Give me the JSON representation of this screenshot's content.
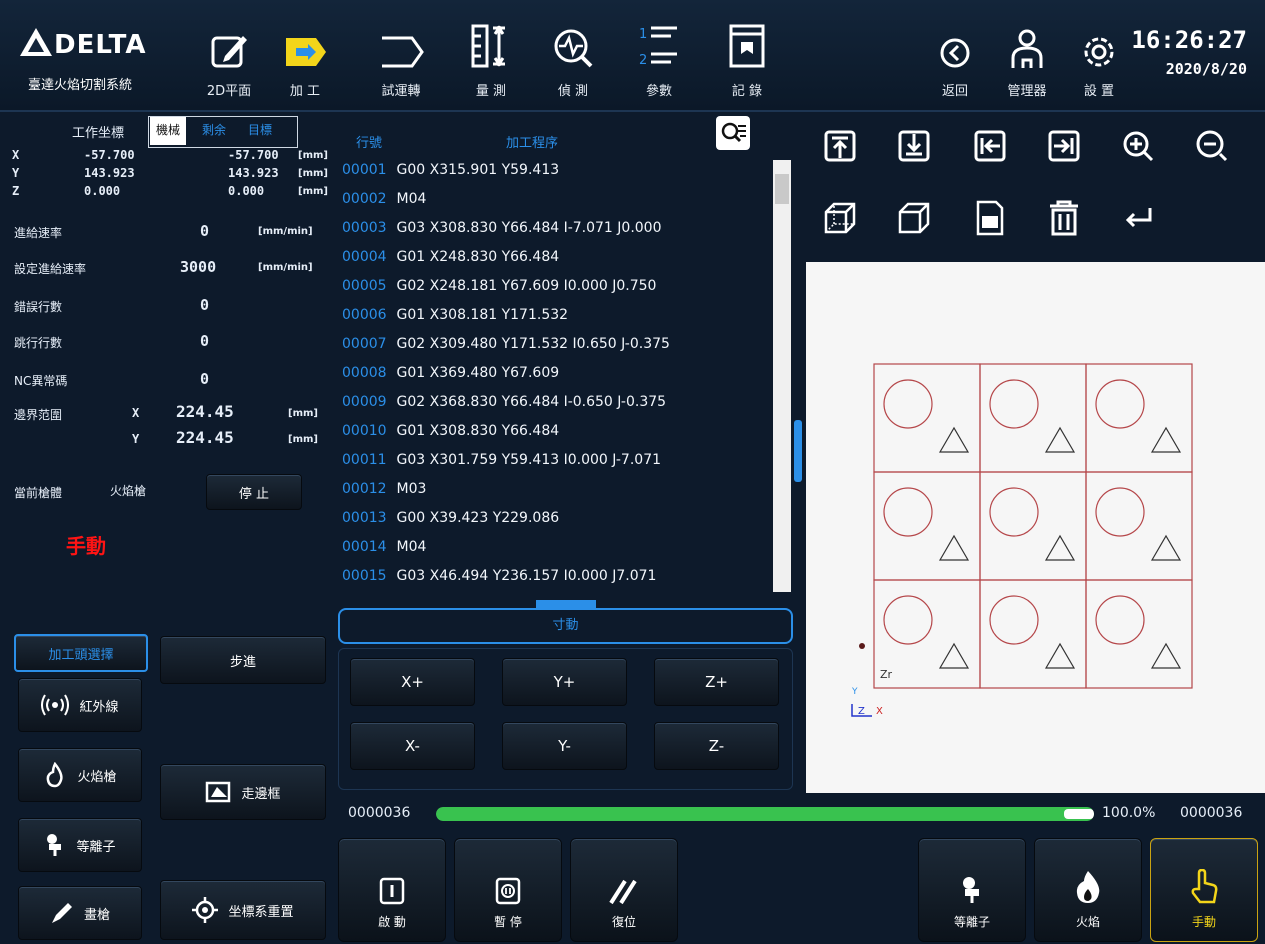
{
  "brand": {
    "name": "DELTA",
    "subtitle": "臺達火焰切割系統"
  },
  "toolbar": [
    {
      "key": "plane",
      "label": "2D平面",
      "icon": "edit-icon"
    },
    {
      "key": "process",
      "label": "加 工",
      "icon": "arrow-right-icon"
    },
    {
      "key": "trial",
      "label": "試運轉",
      "icon": "trial-run-icon"
    },
    {
      "key": "measure",
      "label": "量 測",
      "icon": "measure-icon"
    },
    {
      "key": "detect",
      "label": "偵 測",
      "icon": "detect-icon"
    },
    {
      "key": "params",
      "label": "參數",
      "icon": "parameters-icon"
    },
    {
      "key": "record",
      "label": "記 錄",
      "icon": "record-icon"
    },
    {
      "key": "back",
      "label": "返回",
      "icon": "back-icon"
    },
    {
      "key": "manager",
      "label": "管理器",
      "icon": "user-icon"
    },
    {
      "key": "settings",
      "label": "設 置",
      "icon": "gear-icon"
    }
  ],
  "clock": {
    "time": "16:26:27",
    "date": "2020/8/20"
  },
  "coords": {
    "header": "工作坐標",
    "tabs": [
      "機械",
      "剩余",
      "目標"
    ],
    "axes": [
      {
        "axis": "X",
        "work": "-57.700",
        "machine": "-57.700",
        "unit": "[mm]"
      },
      {
        "axis": "Y",
        "work": "143.923",
        "machine": "143.923",
        "unit": "[mm]"
      },
      {
        "axis": "Z",
        "work": "0.000",
        "machine": "0.000",
        "unit": "[mm]"
      }
    ]
  },
  "status": {
    "feed_label": "進給速率",
    "feed_value": "0",
    "feed_unit": "[mm/min]",
    "set_feed_label": "設定進給速率",
    "set_feed_value": "3000",
    "set_feed_unit": "[mm/min]",
    "err_label": "錯誤行數",
    "err_value": "0",
    "skip_label": "跳行行數",
    "skip_value": "0",
    "nc_label": "NC異常碼",
    "nc_value": "0",
    "boundary_label": "邊界范圍",
    "bx_label": "X",
    "bx_value": "224.45",
    "by_label": "Y",
    "by_value": "224.45",
    "b_unit": "[mm]",
    "torch_label": "當前槍體",
    "torch_value": "火焰槍",
    "stop_label": "停 止",
    "mode": "手動"
  },
  "program": {
    "col_line": "行號",
    "col_program": "加工程序",
    "lines": [
      {
        "n": "00001",
        "code": "G00 X315.901 Y59.413"
      },
      {
        "n": "00002",
        "code": "M04"
      },
      {
        "n": "00003",
        "code": "G03 X308.830 Y66.484 I-7.071 J0.000"
      },
      {
        "n": "00004",
        "code": "G01 X248.830 Y66.484"
      },
      {
        "n": "00005",
        "code": "G02 X248.181 Y67.609 I0.000 J0.750"
      },
      {
        "n": "00006",
        "code": "G01 X308.181 Y171.532"
      },
      {
        "n": "00007",
        "code": "G02 X309.480 Y171.532 I0.650 J-0.375"
      },
      {
        "n": "00008",
        "code": "G01 X369.480 Y67.609"
      },
      {
        "n": "00009",
        "code": "G02 X368.830 Y66.484 I-0.650 J-0.375"
      },
      {
        "n": "00010",
        "code": "G01 X308.830 Y66.484"
      },
      {
        "n": "00011",
        "code": "G03 X301.759 Y59.413 I0.000 J-7.071"
      },
      {
        "n": "00012",
        "code": "M03"
      },
      {
        "n": "00013",
        "code": "G00 X39.423 Y229.086"
      },
      {
        "n": "00014",
        "code": "M04"
      },
      {
        "n": "00015",
        "code": "G03 X46.494 Y236.157 I0.000 J7.071"
      }
    ]
  },
  "jog": {
    "title": "寸動",
    "buttons": [
      "X+",
      "Y+",
      "Z+",
      "X-",
      "Y-",
      "Z-"
    ]
  },
  "left_buttons": {
    "select": "加工頭選擇",
    "step": "步進",
    "infrared": "紅外線",
    "flame": "火焰槍",
    "plasma": "等離子",
    "pen": "畫槍",
    "frame": "走邊框",
    "reset_coord": "坐標系重置"
  },
  "progress": {
    "start": "0000036",
    "percent": "100.0%",
    "end": "0000036",
    "fraction": 1.0
  },
  "bottom_buttons": [
    {
      "key": "start",
      "label": "啟 動",
      "icon": "start-icon"
    },
    {
      "key": "pause",
      "label": "暫 停",
      "icon": "pause-icon"
    },
    {
      "key": "reset",
      "label": "復位",
      "icon": "reset-icon"
    },
    {
      "key": "plasma",
      "label": "等離子",
      "icon": "plasma-icon"
    },
    {
      "key": "flame",
      "label": "火焰",
      "icon": "flame-icon"
    },
    {
      "key": "manual",
      "label": "手動",
      "icon": "hand-icon"
    }
  ],
  "view_tools": [
    "view-top-icon",
    "view-bottom-icon",
    "view-left-icon",
    "view-right-icon",
    "zoom-in-icon",
    "zoom-out-icon",
    "view-iso-icon",
    "view-solid-icon",
    "export-icon",
    "delete-icon",
    "undo-icon"
  ],
  "canvas": {
    "axis_y": "Y",
    "axis_z": "Z",
    "axis_x": "X",
    "label_z": "Zr",
    "shape_color": "#b5474a"
  }
}
